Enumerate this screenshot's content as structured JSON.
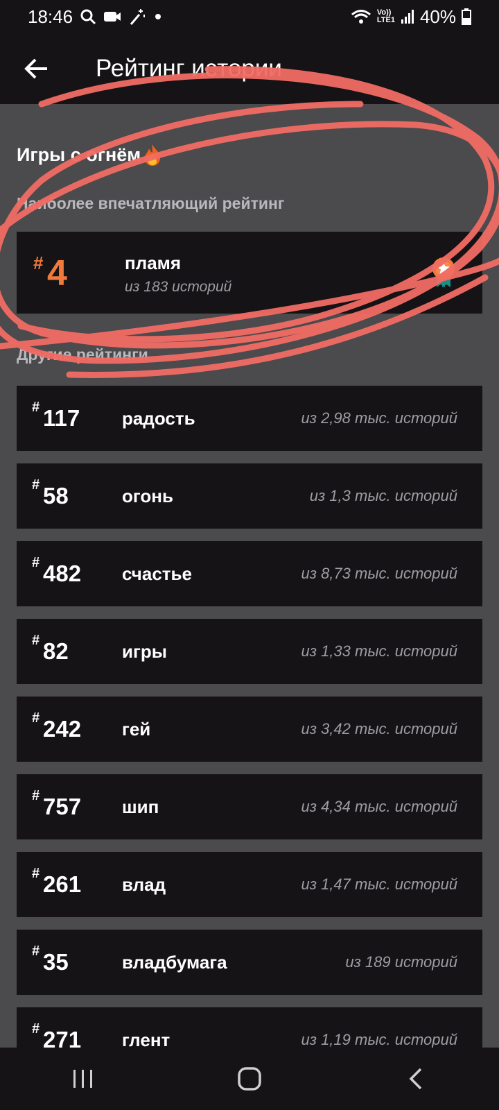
{
  "status_bar": {
    "time": "18:46",
    "battery": "40%",
    "network": "LTE1",
    "volte": "Vo))"
  },
  "app_bar": {
    "title": "Рейтинг истории"
  },
  "section": {
    "title": "Игры с огнём",
    "subtitle": "Наиболее впечатляющий рейтинг"
  },
  "featured": {
    "hash": "#",
    "rank": "4",
    "tag": "пламя",
    "count": "из 183 историй",
    "accent_color": "#f07a3c",
    "badge_icon": "medal-icon"
  },
  "other": {
    "label": "Другие рейтинги",
    "items": [
      {
        "hash": "#",
        "rank": "117",
        "tag": "радость",
        "count": "из 2,98 тыс. историй"
      },
      {
        "hash": "#",
        "rank": "58",
        "tag": "огонь",
        "count": "из 1,3 тыс. историй"
      },
      {
        "hash": "#",
        "rank": "482",
        "tag": "счастье",
        "count": "из 8,73 тыс. историй"
      },
      {
        "hash": "#",
        "rank": "82",
        "tag": "игры",
        "count": "из 1,33 тыс. историй"
      },
      {
        "hash": "#",
        "rank": "242",
        "tag": "гей",
        "count": "из 3,42 тыс. историй"
      },
      {
        "hash": "#",
        "rank": "757",
        "tag": "шип",
        "count": "из 4,34 тыс. историй"
      },
      {
        "hash": "#",
        "rank": "261",
        "tag": "влад",
        "count": "из 1,47 тыс. историй"
      },
      {
        "hash": "#",
        "rank": "35",
        "tag": "владбумага",
        "count": "из 189 историй"
      },
      {
        "hash": "#",
        "rank": "271",
        "tag": "глент",
        "count": "из 1,19 тыс. историй"
      }
    ]
  },
  "colors": {
    "background": "#4b4a4d",
    "card": "#151316",
    "accent": "#f07a3c",
    "annotation": "#f26c64"
  }
}
